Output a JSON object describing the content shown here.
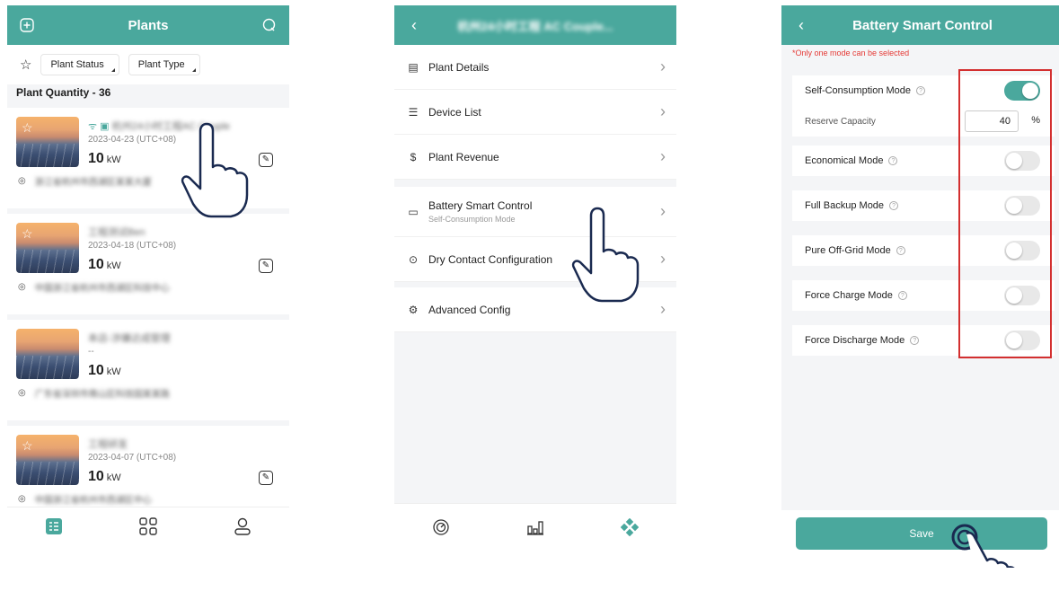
{
  "plants_screen": {
    "title": "Plants",
    "filters": {
      "plant_status": "Plant Status",
      "plant_type": "Plant Type"
    },
    "quantity_label": "Plant Quantity - 36",
    "plants": [
      {
        "name": "杭州24小时工程AC Couple",
        "date": "2023-04-23 (UTC+08)",
        "power": "10",
        "unit": "kW",
        "address": "浙江省杭州市西湖区某某大厦"
      },
      {
        "name": "工程测试Ben",
        "date": "2023-04-18 (UTC+08)",
        "power": "10",
        "unit": "kW",
        "address": "中国浙江省杭州市西湖区科技中心"
      },
      {
        "name": "本店-涉嫌达成管理",
        "date": "--",
        "power": "10",
        "unit": "kW",
        "address": "广东省深圳市南山区科技园某某路"
      },
      {
        "name": "工程研发",
        "date": "2023-04-07 (UTC+08)",
        "power": "10",
        "unit": "kW",
        "address": "中国浙江省杭州市西湖区中心"
      }
    ]
  },
  "plant_menu_screen": {
    "title": "杭州24小时工程 AC Couple...",
    "items": [
      {
        "label": "Plant Details"
      },
      {
        "label": "Device List"
      },
      {
        "label": "Plant Revenue"
      },
      {
        "label": "Battery Smart Control",
        "sub": "Self-Consumption Mode"
      },
      {
        "label": "Dry Contact Configuration"
      },
      {
        "label": "Advanced Config"
      }
    ]
  },
  "battery_screen": {
    "title": "Battery Smart Control",
    "notice": "*Only one mode can be selected",
    "modes": [
      {
        "label": "Self-Consumption Mode",
        "enabled": true
      },
      {
        "label": "Economical Mode",
        "enabled": false
      },
      {
        "label": "Full Backup Mode",
        "enabled": false
      },
      {
        "label": "Pure Off-Grid Mode",
        "enabled": false
      },
      {
        "label": "Force Charge Mode",
        "enabled": false
      },
      {
        "label": "Force Discharge Mode",
        "enabled": false
      }
    ],
    "reserve_label": "Reserve Capacity",
    "reserve_value": "40",
    "reserve_unit": "%",
    "save_label": "Save"
  },
  "colors": {
    "accent": "#4aa89d",
    "highlight": "#d32f2f",
    "notice": "#e53935"
  },
  "icons": [
    "add-icon",
    "search-icon",
    "star-icon",
    "back-icon",
    "chevron-right-icon",
    "edit-icon",
    "location-icon",
    "list-icon",
    "grid-icon",
    "user-icon",
    "gauge-icon",
    "chart-icon",
    "diamond-icon",
    "hand-pointer-icon"
  ]
}
